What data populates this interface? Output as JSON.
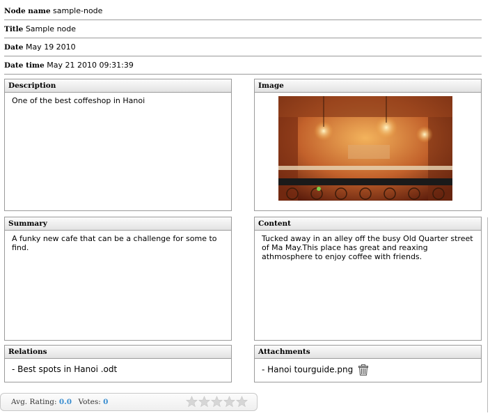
{
  "properties": [
    {
      "label": "Node name",
      "value": "sample-node"
    },
    {
      "label": "Title",
      "value": "Sample node"
    },
    {
      "label": "Date",
      "value": "May 19 2010"
    },
    {
      "label": "Date time",
      "value": "May 21 2010 09:31:39"
    }
  ],
  "panels": {
    "description": {
      "title": "Description",
      "text": "One of the best coffeshop in Hanoi"
    },
    "image": {
      "title": "Image",
      "icon": "cafe-photo"
    },
    "summary": {
      "title": "Summary",
      "text": "A funky new cafe that can be a challenge for some to find."
    },
    "content": {
      "title": "Content",
      "text": "Tucked away in an alley off the busy Old Quarter street of Ma May.This place has great and reaxing athmosphere to enjoy coffee with friends."
    },
    "relations": {
      "title": "Relations",
      "text": "- Best spots in Hanoi .odt"
    },
    "attachments": {
      "title": "Attachments",
      "text": "- Hanoi tourguide.png",
      "icon": "trash-icon"
    }
  },
  "rating": {
    "avg_label": "Avg. Rating:",
    "avg_value": "0.0",
    "votes_label": "Votes:",
    "votes_value": "0",
    "stars": 0,
    "max_stars": 5,
    "star_color": "#d6d6d6"
  }
}
